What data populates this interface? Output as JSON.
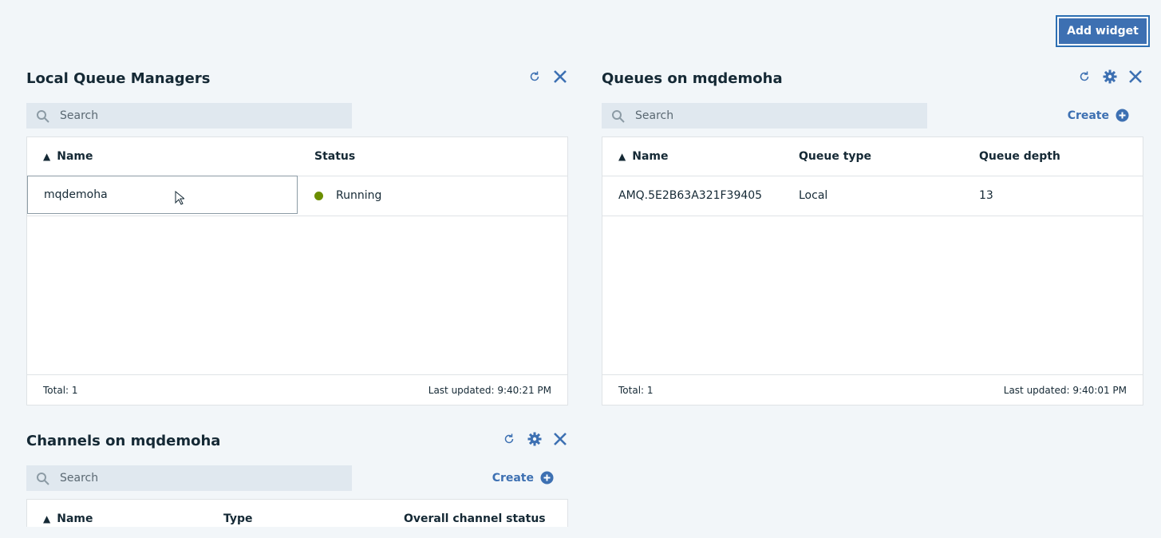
{
  "header": {
    "add_widget_label": "Add widget"
  },
  "widgets": {
    "qmgrs": {
      "title": "Local Queue Managers",
      "search_placeholder": "Search",
      "columns": [
        "Name",
        "Status"
      ],
      "rows": [
        {
          "name": "mqdemoha",
          "status": "Running"
        }
      ],
      "total": "Total: 1",
      "last_updated": "Last updated: 9:40:21 PM",
      "status_color": "#6b8e00"
    },
    "queues": {
      "title": "Queues on mqdemoha",
      "search_placeholder": "Search",
      "create_label": "Create",
      "columns": [
        "Name",
        "Queue type",
        "Queue depth"
      ],
      "rows": [
        {
          "name": "AMQ.5E2B63A321F39405",
          "type": "Local",
          "depth": "13"
        }
      ],
      "total": "Total: 1",
      "last_updated": "Last updated: 9:40:01 PM"
    },
    "channels": {
      "title": "Channels on mqdemoha",
      "search_placeholder": "Search",
      "create_label": "Create",
      "columns": [
        "Name",
        "Type",
        "Overall channel status"
      ]
    }
  },
  "icons": {
    "refresh": "refresh-icon",
    "close": "close-icon",
    "settings": "gear-icon",
    "search": "search-icon",
    "add": "add-circle-icon",
    "sort": "sort-ascending-icon"
  },
  "colors": {
    "accent": "#3d70b2",
    "background": "#f2f6f9",
    "search_bg": "#e0e8ef"
  }
}
